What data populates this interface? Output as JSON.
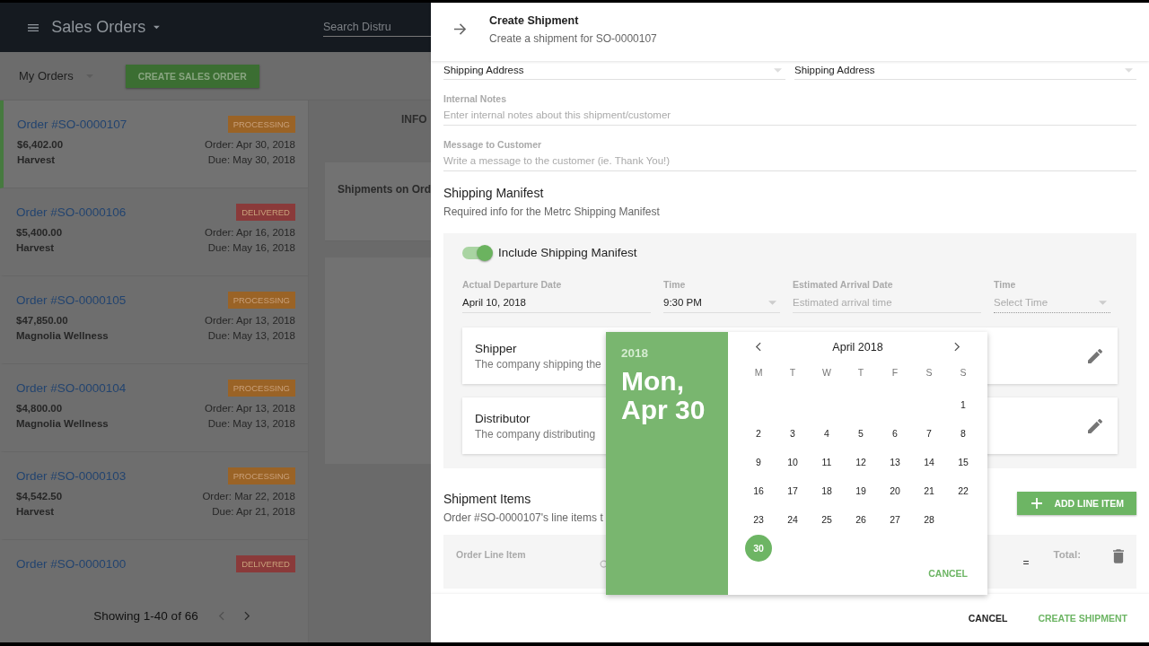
{
  "app_header": {
    "title": "Sales Orders",
    "search_placeholder": "Search Distru"
  },
  "toolbar": {
    "filter": "My Orders",
    "create_button": "CREATE SALES ORDER"
  },
  "orders": [
    {
      "number": "Order #SO-0000107",
      "status": "PROCESSING",
      "color": "#9a6326",
      "amount": "$6,402.00",
      "customer": "Harvest",
      "order_date": "Order: Apr 30, 2018",
      "due_date": "Due: May 30, 2018",
      "selected": true
    },
    {
      "number": "Order #SO-0000106",
      "status": "DELIVERED",
      "color": "#8a3a3a",
      "amount": "$5,400.00",
      "customer": "Harvest",
      "order_date": "Order: Apr 16, 2018",
      "due_date": "Due: May 16, 2018",
      "selected": false
    },
    {
      "number": "Order #SO-0000105",
      "status": "PROCESSING",
      "color": "#9a6326",
      "amount": "$47,850.00",
      "customer": "Magnolia Wellness",
      "order_date": "Order: Apr 13, 2018",
      "due_date": "Due: May 13, 2018",
      "selected": false
    },
    {
      "number": "Order #SO-0000104",
      "status": "PROCESSING",
      "color": "#9a6326",
      "amount": "$4,800.00",
      "customer": "Magnolia Wellness",
      "order_date": "Order: Apr 13, 2018",
      "due_date": "Due: May 13, 2018",
      "selected": false
    },
    {
      "number": "Order #SO-0000103",
      "status": "PROCESSING",
      "color": "#9a6326",
      "amount": "$4,542.50",
      "customer": "Harvest",
      "order_date": "Order: Mar 22, 2018",
      "due_date": "Due: Apr 21, 2018",
      "selected": false
    },
    {
      "number": "Order #SO-0000100",
      "status": "DELIVERED",
      "color": "#8a3a3a",
      "selected": false
    }
  ],
  "pagination": {
    "text": "Showing 1-40 of 66"
  },
  "detail_panel": {
    "tab": "INFO",
    "card_title": "Shipments on Ord"
  },
  "drawer": {
    "title": "Create Shipment",
    "subtitle": "Create a shipment for SO-0000107"
  },
  "address_fields": [
    "Shipping Address",
    "Shipping Address"
  ],
  "internal_notes": {
    "label": "Internal Notes",
    "placeholder": "Enter internal notes about this shipment/customer"
  },
  "message": {
    "label": "Message to Customer",
    "placeholder": "Write a message to the customer (ie. Thank You!)"
  },
  "manifest": {
    "title": "Shipping Manifest",
    "subtitle": "Required info for the Metrc Shipping Manifest",
    "include": {
      "label": "Include Shipping Manifest",
      "on": true
    },
    "fields": [
      {
        "label": "Actual Departure Date",
        "value": "April 10, 2018",
        "kind": "text"
      },
      {
        "label": "Time",
        "value": "9:30 PM",
        "kind": "select"
      },
      {
        "label": "Estimated Arrival Date",
        "placeholder": "Estimated arrival time",
        "kind": "text"
      },
      {
        "label": "Time",
        "placeholder": "Select Time",
        "kind": "select"
      }
    ],
    "parties": [
      {
        "title": "Shipper",
        "description": "The company shipping the"
      },
      {
        "title": "Distributor",
        "description": "The company distributing"
      }
    ]
  },
  "date_picker": {
    "year": "2018",
    "date_lines": [
      "Mon,",
      "Apr 30"
    ],
    "month": "April 2018",
    "weekdays": [
      "M",
      "T",
      "W",
      "T",
      "F",
      "S",
      "S"
    ],
    "weeks": [
      {
        "kind": "end",
        "days": [
          {
            "label": "1",
            "selected": false
          }
        ]
      },
      {
        "kind": "full",
        "days": [
          {
            "label": "2",
            "selected": false
          },
          {
            "label": "3",
            "selected": false
          },
          {
            "label": "4",
            "selected": false
          },
          {
            "label": "5",
            "selected": false
          },
          {
            "label": "6",
            "selected": false
          },
          {
            "label": "7",
            "selected": false
          },
          {
            "label": "8",
            "selected": false
          }
        ]
      },
      {
        "kind": "full",
        "days": [
          {
            "label": "9",
            "selected": false
          },
          {
            "label": "10",
            "selected": false
          },
          {
            "label": "11",
            "selected": false
          },
          {
            "label": "12",
            "selected": false
          },
          {
            "label": "13",
            "selected": false
          },
          {
            "label": "14",
            "selected": false
          },
          {
            "label": "15",
            "selected": false
          }
        ]
      },
      {
        "kind": "full",
        "days": [
          {
            "label": "16",
            "selected": false
          },
          {
            "label": "17",
            "selected": false
          },
          {
            "label": "18",
            "selected": false
          },
          {
            "label": "19",
            "selected": false
          },
          {
            "label": "20",
            "selected": false
          },
          {
            "label": "21",
            "selected": false
          },
          {
            "label": "22",
            "selected": false
          }
        ]
      },
      {
        "kind": "full",
        "days": [
          {
            "label": "23",
            "selected": false
          },
          {
            "label": "24",
            "selected": false
          },
          {
            "label": "25",
            "selected": false
          },
          {
            "label": "26",
            "selected": false
          },
          {
            "label": "27",
            "selected": false
          },
          {
            "label": "28",
            "selected": false
          }
        ]
      },
      {
        "kind": "start",
        "days": [
          {
            "label": "30",
            "selected": true
          }
        ]
      }
    ],
    "cancel": "CANCEL"
  },
  "shipment_items": {
    "title": "Shipment Items",
    "subtitle": "Order #SO-0000107's line items t",
    "add_button": "ADD LINE ITEM",
    "line_item_label": "Order Line Item",
    "equals": "=",
    "total_label": "Total:"
  },
  "footer": {
    "cancel": "CANCEL",
    "create": "CREATE SHIPMENT"
  }
}
